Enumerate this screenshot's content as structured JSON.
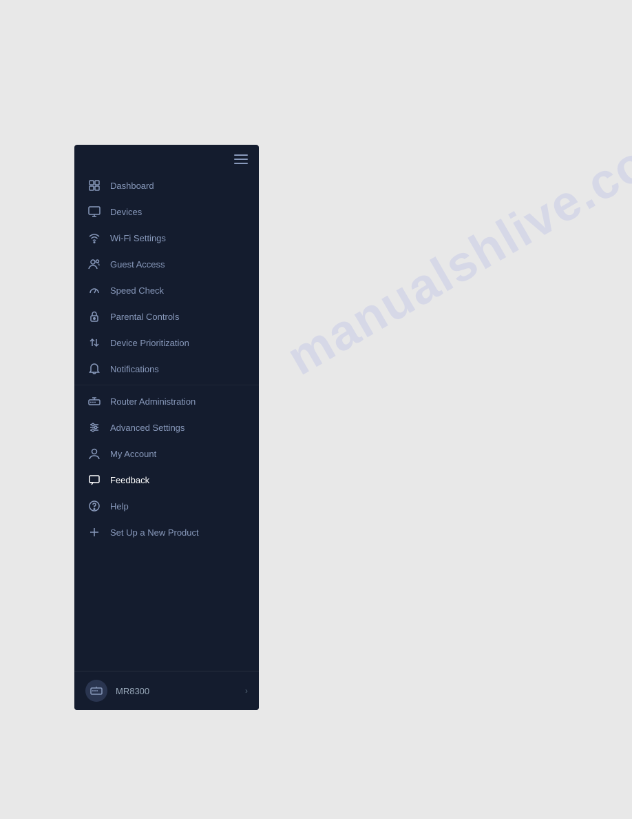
{
  "watermark": "manualshlive.com",
  "sidebar": {
    "background": "#141c2e",
    "nav_items": [
      {
        "id": "dashboard",
        "label": "Dashboard",
        "icon": "grid-icon",
        "active": false
      },
      {
        "id": "devices",
        "label": "Devices",
        "icon": "monitor-icon",
        "active": false
      },
      {
        "id": "wifi-settings",
        "label": "Wi-Fi Settings",
        "icon": "wifi-icon",
        "active": false
      },
      {
        "id": "guest-access",
        "label": "Guest Access",
        "icon": "users-icon",
        "active": false
      },
      {
        "id": "speed-check",
        "label": "Speed Check",
        "icon": "speedometer-icon",
        "active": false
      },
      {
        "id": "parental-controls",
        "label": "Parental Controls",
        "icon": "lock-icon",
        "active": false
      },
      {
        "id": "device-prioritization",
        "label": "Device Prioritization",
        "icon": "arrows-icon",
        "active": false
      },
      {
        "id": "notifications",
        "label": "Notifications",
        "icon": "bell-icon",
        "active": false
      },
      {
        "id": "router-administration",
        "label": "Router Administration",
        "icon": "router-icon",
        "active": false
      },
      {
        "id": "advanced-settings",
        "label": "Advanced Settings",
        "icon": "sliders-icon",
        "active": false
      },
      {
        "id": "my-account",
        "label": "My Account",
        "icon": "user-icon",
        "active": false
      },
      {
        "id": "feedback",
        "label": "Feedback",
        "icon": "chat-icon",
        "active": true
      },
      {
        "id": "help",
        "label": "Help",
        "icon": "question-icon",
        "active": false
      },
      {
        "id": "setup-new",
        "label": "Set Up a New Product",
        "icon": "plus-icon",
        "active": false
      }
    ],
    "device": {
      "name": "MR8300",
      "icon": "router-device-icon"
    }
  }
}
